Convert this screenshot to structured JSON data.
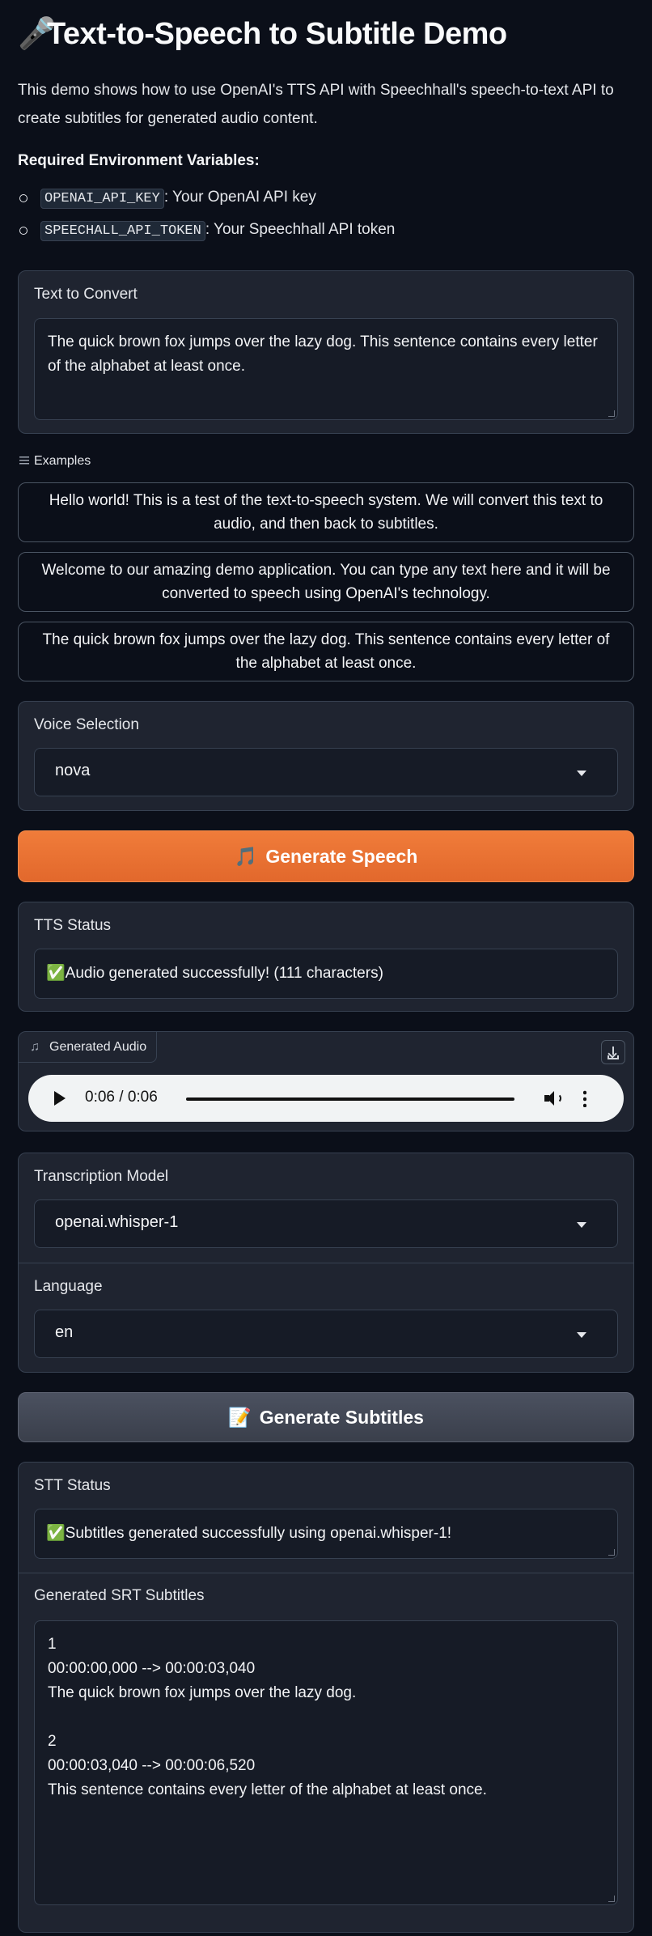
{
  "header": {
    "mic_icon": "🎤",
    "title": "Text-to-Speech to Subtitle Demo",
    "intro": "This demo shows how to use OpenAI's TTS API with Speechhall's speech-to-text API to create subtitles for generated audio content.",
    "env_heading": "Required Environment Variables:",
    "env_vars": [
      {
        "code": "OPENAI_API_KEY",
        "desc": ": Your OpenAI API key"
      },
      {
        "code": "SPEECHALL_API_TOKEN",
        "desc": ": Your Speechhall API token"
      }
    ]
  },
  "text_input": {
    "label": "Text to Convert",
    "value": "The quick brown fox jumps over the lazy dog. This sentence contains every letter of the alphabet at least once."
  },
  "examples": {
    "label": "Examples",
    "items": [
      "Hello world! This is a test of the text-to-speech system. We will convert this text to audio, and then back to subtitles.",
      "Welcome to our amazing demo application. You can type any text here and it will be converted to speech using OpenAI's technology.",
      "The quick brown fox jumps over the lazy dog. This sentence contains every letter of the alphabet at least once."
    ]
  },
  "voice": {
    "label": "Voice Selection",
    "value": "nova"
  },
  "generate_speech": {
    "icon": "🎵",
    "label": "Generate Speech"
  },
  "tts_status": {
    "label": "TTS Status",
    "icon": "✅",
    "value": "Audio generated successfully! (111 characters)"
  },
  "audio": {
    "label": "Generated Audio",
    "note_icon": "♫",
    "time": "0:06 / 0:06",
    "progress": 1.0
  },
  "transcription": {
    "label": "Transcription Model",
    "value": "openai.whisper-1"
  },
  "language": {
    "label": "Language",
    "value": "en"
  },
  "generate_subtitles": {
    "icon": "📝",
    "label": "Generate Subtitles"
  },
  "stt_status": {
    "label": "STT Status",
    "icon": "✅",
    "value": "Subtitles generated successfully using openai.whisper-1!"
  },
  "srt": {
    "label": "Generated SRT Subtitles",
    "value": "1\n00:00:00,000 --> 00:00:03,040\nThe quick brown fox jumps over the lazy dog.\n\n2\n00:00:03,040 --> 00:00:06,520\nThis sentence contains every letter of the alphabet at least once."
  },
  "colors": {
    "background": "#0b0f19",
    "panel": "#1f2430",
    "primary_button": "#e2682c",
    "secondary_button": "#3a3f4b"
  }
}
